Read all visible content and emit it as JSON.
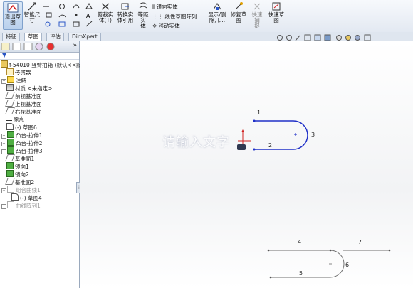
{
  "ribbon": {
    "exit_sketch": "退出草\n图",
    "smart_dimension": "智能尺\n寸",
    "trim": "剪裁实\n体(T)",
    "convert": "转换实\n体引用",
    "offset": "等距实\n体",
    "mirror": "镜向实体",
    "linear_pattern": "线性草图阵列",
    "move": "移动实体",
    "show_delete": "显示/删\n除几...",
    "repair": "修复草\n图",
    "quick_snap": "快速捕\n捉",
    "quick_sketch": "快速草\n图"
  },
  "tabs": [
    "特征",
    "草图",
    "评估",
    "DimXpert"
  ],
  "tree": {
    "root": "f-54010 竖臂拍箱  (默认<<默认",
    "items": [
      {
        "label": "传感器"
      },
      {
        "label": "注解"
      },
      {
        "label": "材质 <未指定>"
      },
      {
        "label": "前视基准面"
      },
      {
        "label": "上视基准面"
      },
      {
        "label": "右视基准面"
      },
      {
        "label": "原点"
      },
      {
        "label": "(-) 草图6"
      },
      {
        "label": "凸台-拉伸1"
      },
      {
        "label": "凸台-拉伸2"
      },
      {
        "label": "凸台-拉伸3"
      },
      {
        "label": "基准面1"
      },
      {
        "label": "镜向1"
      },
      {
        "label": "镜向2"
      },
      {
        "label": "基准面2"
      },
      {
        "label": "组合曲线1"
      },
      {
        "label": "(-) 草图4"
      },
      {
        "label": "曲线阵列1"
      }
    ]
  },
  "canvas": {
    "labels": [
      "1",
      "2",
      "3",
      "4",
      "5",
      "6",
      "7"
    ],
    "watermark": "请输入文字"
  }
}
